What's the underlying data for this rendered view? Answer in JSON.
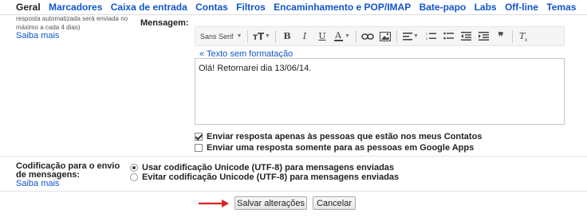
{
  "tabs": [
    "Geral",
    "Marcadores",
    "Caixa de entrada",
    "Contas",
    "Filtros",
    "Encaminhamento e POP/IMAP",
    "Bate-papo",
    "Labs",
    "Off-line",
    "Temas"
  ],
  "vacation": {
    "note_line1": "resposta automatizada será enviada no",
    "note_line2": "máximo a cada 4 dias)",
    "learn_more": "Saiba mais",
    "message_label": "Mensagem:",
    "font_name": "Sans Serif",
    "plain_text_link": "« Texto sem formatação",
    "message_text": "Olá! Retornarei dia 13/06/14.",
    "only_contacts": "Enviar resposta apenas às pessoas que estão nos meus Contatos",
    "only_domain": "Enviar uma resposta somente para as pessoas em Google Apps"
  },
  "encoding": {
    "label_line1": "Codificação para o envio",
    "label_line2": "de mensagens:",
    "learn_more": "Saiba mais",
    "use_unicode": "Usar codificação Unicode (UTF-8) para mensagens enviadas",
    "avoid_unicode": "Evitar codificação Unicode (UTF-8) para mensagens enviadas"
  },
  "actions": {
    "save": "Salvar alterações",
    "cancel": "Cancelar"
  },
  "colors": {
    "link": "#1155cc",
    "arrow": "#e02020"
  }
}
